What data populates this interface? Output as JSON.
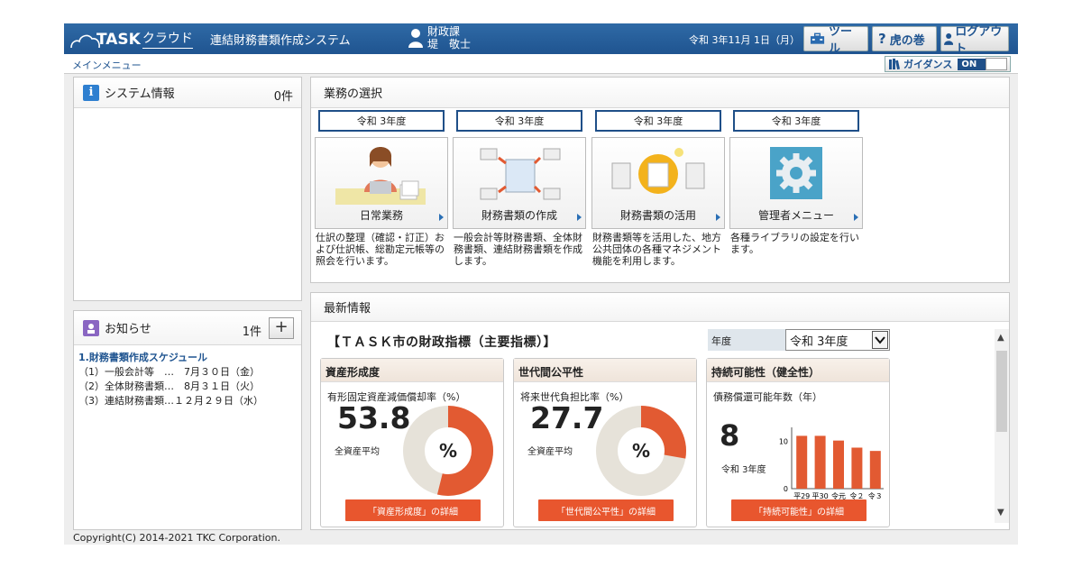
{
  "header": {
    "logo_text": "TASK",
    "logo_kana": "クラウド",
    "system_title": "連結財務書類作成システム",
    "user_dept": "財政課",
    "user_name": "堤　敬士",
    "date": "令和 3年11月 1日（月）",
    "tool_label": "ツール",
    "help_label": "虎の巻",
    "logout_label": "ログアウト"
  },
  "subbar": {
    "menu_link": "メインメニュー",
    "guidance_label": "ガイダンス",
    "guidance_state": "ON"
  },
  "system_info": {
    "title": "システム情報",
    "count": "0件"
  },
  "notices": {
    "title": "お知らせ",
    "count": "1件",
    "add_label": "+",
    "item_title": "1.財務書類作成スケジュール",
    "lines": [
      "（1）一般会計等　…　7月３０日（金）",
      "（2）全体財務書類…　8月３１日（火）",
      "（3）連結財務書類…１２月２９日（水）"
    ]
  },
  "business": {
    "title": "業務の選択",
    "tasks": [
      {
        "year": "令和 3年度",
        "label": "日常業務",
        "desc": "仕訳の整理（確認・訂正）および仕訳帳、総勘定元帳等の照会を行います。"
      },
      {
        "year": "令和 3年度",
        "label": "財務書類の作成",
        "desc": "一般会計等財務書類、全体財務書類、連結財務書類を作成します。"
      },
      {
        "year": "令和 3年度",
        "label": "財務書類の活用",
        "desc": "財務書類等を活用した、地方公共団体の各種マネジメント機能を利用します。"
      },
      {
        "year": "令和 3年度",
        "label": "管理者メニュー",
        "desc": "各種ライブラリの設定を行います。"
      }
    ]
  },
  "latest": {
    "title": "最新情報",
    "fin_title": "【ＴＡＳＫ市の財政指標（主要指標）】",
    "year_label": "年度",
    "year_value": "令和 3年度",
    "cards": [
      {
        "head": "資産形成度",
        "sub": "有形固定資産減価償却率（%）",
        "value": "53.8",
        "label": "全資産平均",
        "pct": 53.8,
        "unit": "%",
        "button": "「資産形成度」の詳細"
      },
      {
        "head": "世代間公平性",
        "sub": "将来世代負担比率（%）",
        "value": "27.7",
        "label": "全資産平均",
        "pct": 27.7,
        "unit": "%",
        "button": "「世代間公平性」の詳細"
      },
      {
        "head": "持続可能性（健全性）",
        "sub": "債務償還可能年数（年）",
        "value": "8",
        "label": "令和 3年度",
        "button": "「持続可能性」の詳細"
      }
    ],
    "colors": {
      "accent": "#e25a32",
      "donut_bg": "#e6e2d9"
    }
  },
  "chart_data": {
    "type": "bar",
    "categories": [
      "平29",
      "平30",
      "令元",
      "令２",
      "令３"
    ],
    "values": [
      11.2,
      11.2,
      10.2,
      8.7,
      8.0
    ],
    "ylim": [
      0,
      13
    ],
    "yticks": [
      0,
      10
    ]
  },
  "footer": {
    "copyright": "Copyright(C) 2014-2021 TKC Corporation."
  }
}
